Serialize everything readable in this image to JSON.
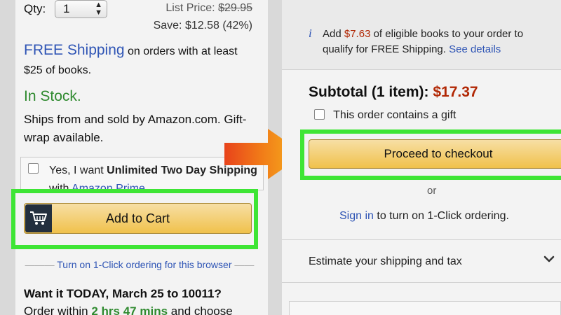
{
  "left": {
    "qty_label": "Qty:",
    "qty_value": "1",
    "list_price_label": "List Price:",
    "list_price_value": "$29.95",
    "save_text": "Save: $12.58 (42%)",
    "free_shipping": "FREE Shipping",
    "shipping_rest": "on orders with at least $25 of books.",
    "in_stock": "In Stock.",
    "ships_from": "Ships from and sold by Amazon.com. Gift-wrap available.",
    "prime_yes": "Yes, I want",
    "prime_bold": "Unlimited Two Day Shipping",
    "prime_with": "with",
    "prime_link": "Amazon Prime",
    "add_to_cart": "Add to Cart",
    "one_click": "Turn on 1-Click ordering for this browser",
    "want_it": "Want it TODAY, March 25 to 10011?",
    "order_within": "Order within",
    "time_left": "2 hrs 47 mins",
    "order_rest": "and choose"
  },
  "right": {
    "notice_add": "Add",
    "notice_amount": "$7.63",
    "notice_rest": "of eligible books to your order to qualify for FREE Shipping.",
    "see_details": "See details",
    "subtotal_label": "Subtotal (1 item):",
    "subtotal_value": "$17.37",
    "gift_label": "This order contains a gift",
    "checkout_button": "Proceed to checkout",
    "or": "or",
    "sign_in": "Sign in",
    "sign_in_rest": "to turn on 1-Click ordering.",
    "estimate": "Estimate your shipping and tax"
  },
  "icons": {
    "cart": "shopping-cart-icon",
    "info": "info-icon",
    "chevron": "chevron-down-icon",
    "arrow": "right-arrow-icon"
  },
  "colors": {
    "highlight": "#3ee535",
    "button": "#f0c14b",
    "link": "#2f55b5",
    "price": "#b12704",
    "stock": "#2f8a2f"
  }
}
